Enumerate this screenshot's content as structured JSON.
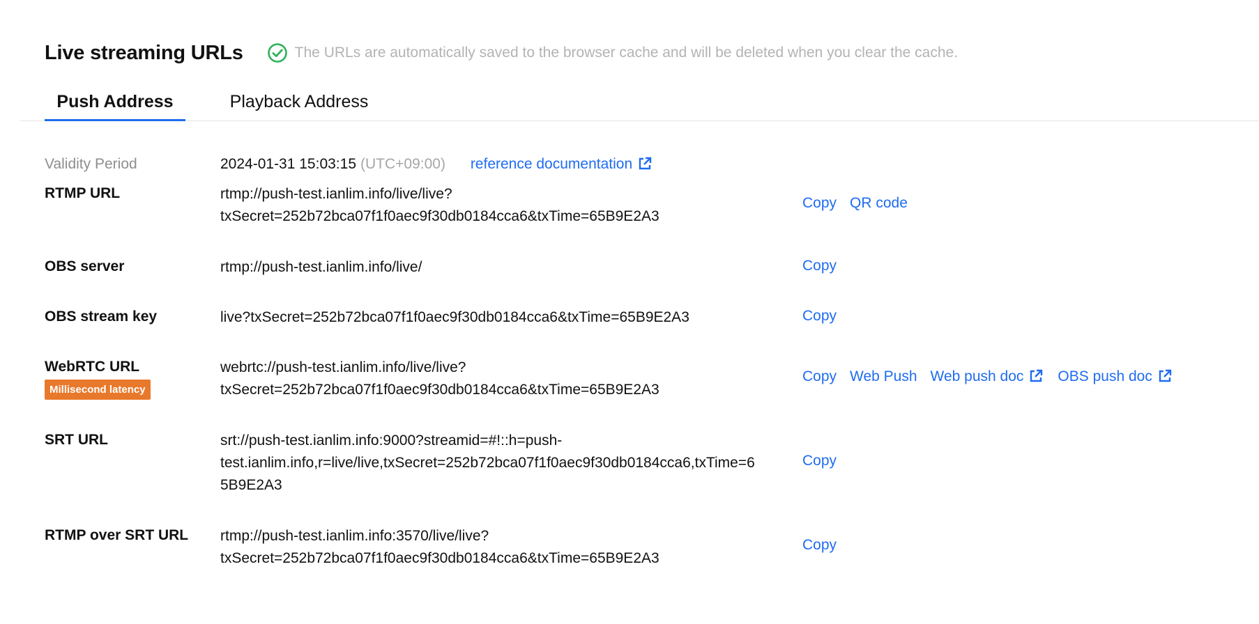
{
  "header": {
    "title": "Live streaming URLs",
    "notice": "The URLs are automatically saved to the browser cache and will be deleted when you clear the cache."
  },
  "tabs": [
    {
      "label": "Push Address",
      "active": true
    },
    {
      "label": "Playback Address",
      "active": false
    }
  ],
  "validity": {
    "label": "Validity Period",
    "date": "2024-01-31 15:03:15",
    "timezone": "(UTC+09:00)",
    "doc_link": "reference documentation"
  },
  "rows": {
    "rtmp": {
      "label": "RTMP URL",
      "line1": "rtmp://push-test.ianlim.info/live/live?",
      "line2": "txSecret=252b72bca07f1f0aec9f30db0184cca6&txTime=65B9E2A3",
      "copy": "Copy",
      "qr": "QR code"
    },
    "obs_server": {
      "label": "OBS server",
      "value": "rtmp://push-test.ianlim.info/live/",
      "copy": "Copy"
    },
    "obs_key": {
      "label": "OBS stream key",
      "value": "live?txSecret=252b72bca07f1f0aec9f30db0184cca6&txTime=65B9E2A3",
      "copy": "Copy"
    },
    "webrtc": {
      "label": "WebRTC URL",
      "badge": "Millisecond latency",
      "line1": "webrtc://push-test.ianlim.info/live/live?",
      "line2": "txSecret=252b72bca07f1f0aec9f30db0184cca6&txTime=65B9E2A3",
      "copy": "Copy",
      "web_push": "Web Push",
      "web_push_doc": "Web push doc",
      "obs_push_doc": "OBS push doc"
    },
    "srt": {
      "label": "SRT URL",
      "line1": "srt://push-test.ianlim.info:9000?streamid=#!::h=push-",
      "line2": "test.ianlim.info,r=live/live,txSecret=252b72bca07f1f0aec9f30db0184cca6,txTime=6",
      "line3": "5B9E2A3",
      "copy": "Copy"
    },
    "rtmp_srt": {
      "label": "RTMP over SRT URL",
      "line1": "rtmp://push-test.ianlim.info:3570/live/live?",
      "line2": "txSecret=252b72bca07f1f0aec9f30db0184cca6&txTime=65B9E2A3",
      "copy": "Copy"
    }
  },
  "colors": {
    "link": "#1f6cf0",
    "success": "#2fb15a",
    "badge": "#e8792c"
  },
  "icons": {
    "notice": "check-circle-icon",
    "external": "external-link-icon"
  }
}
